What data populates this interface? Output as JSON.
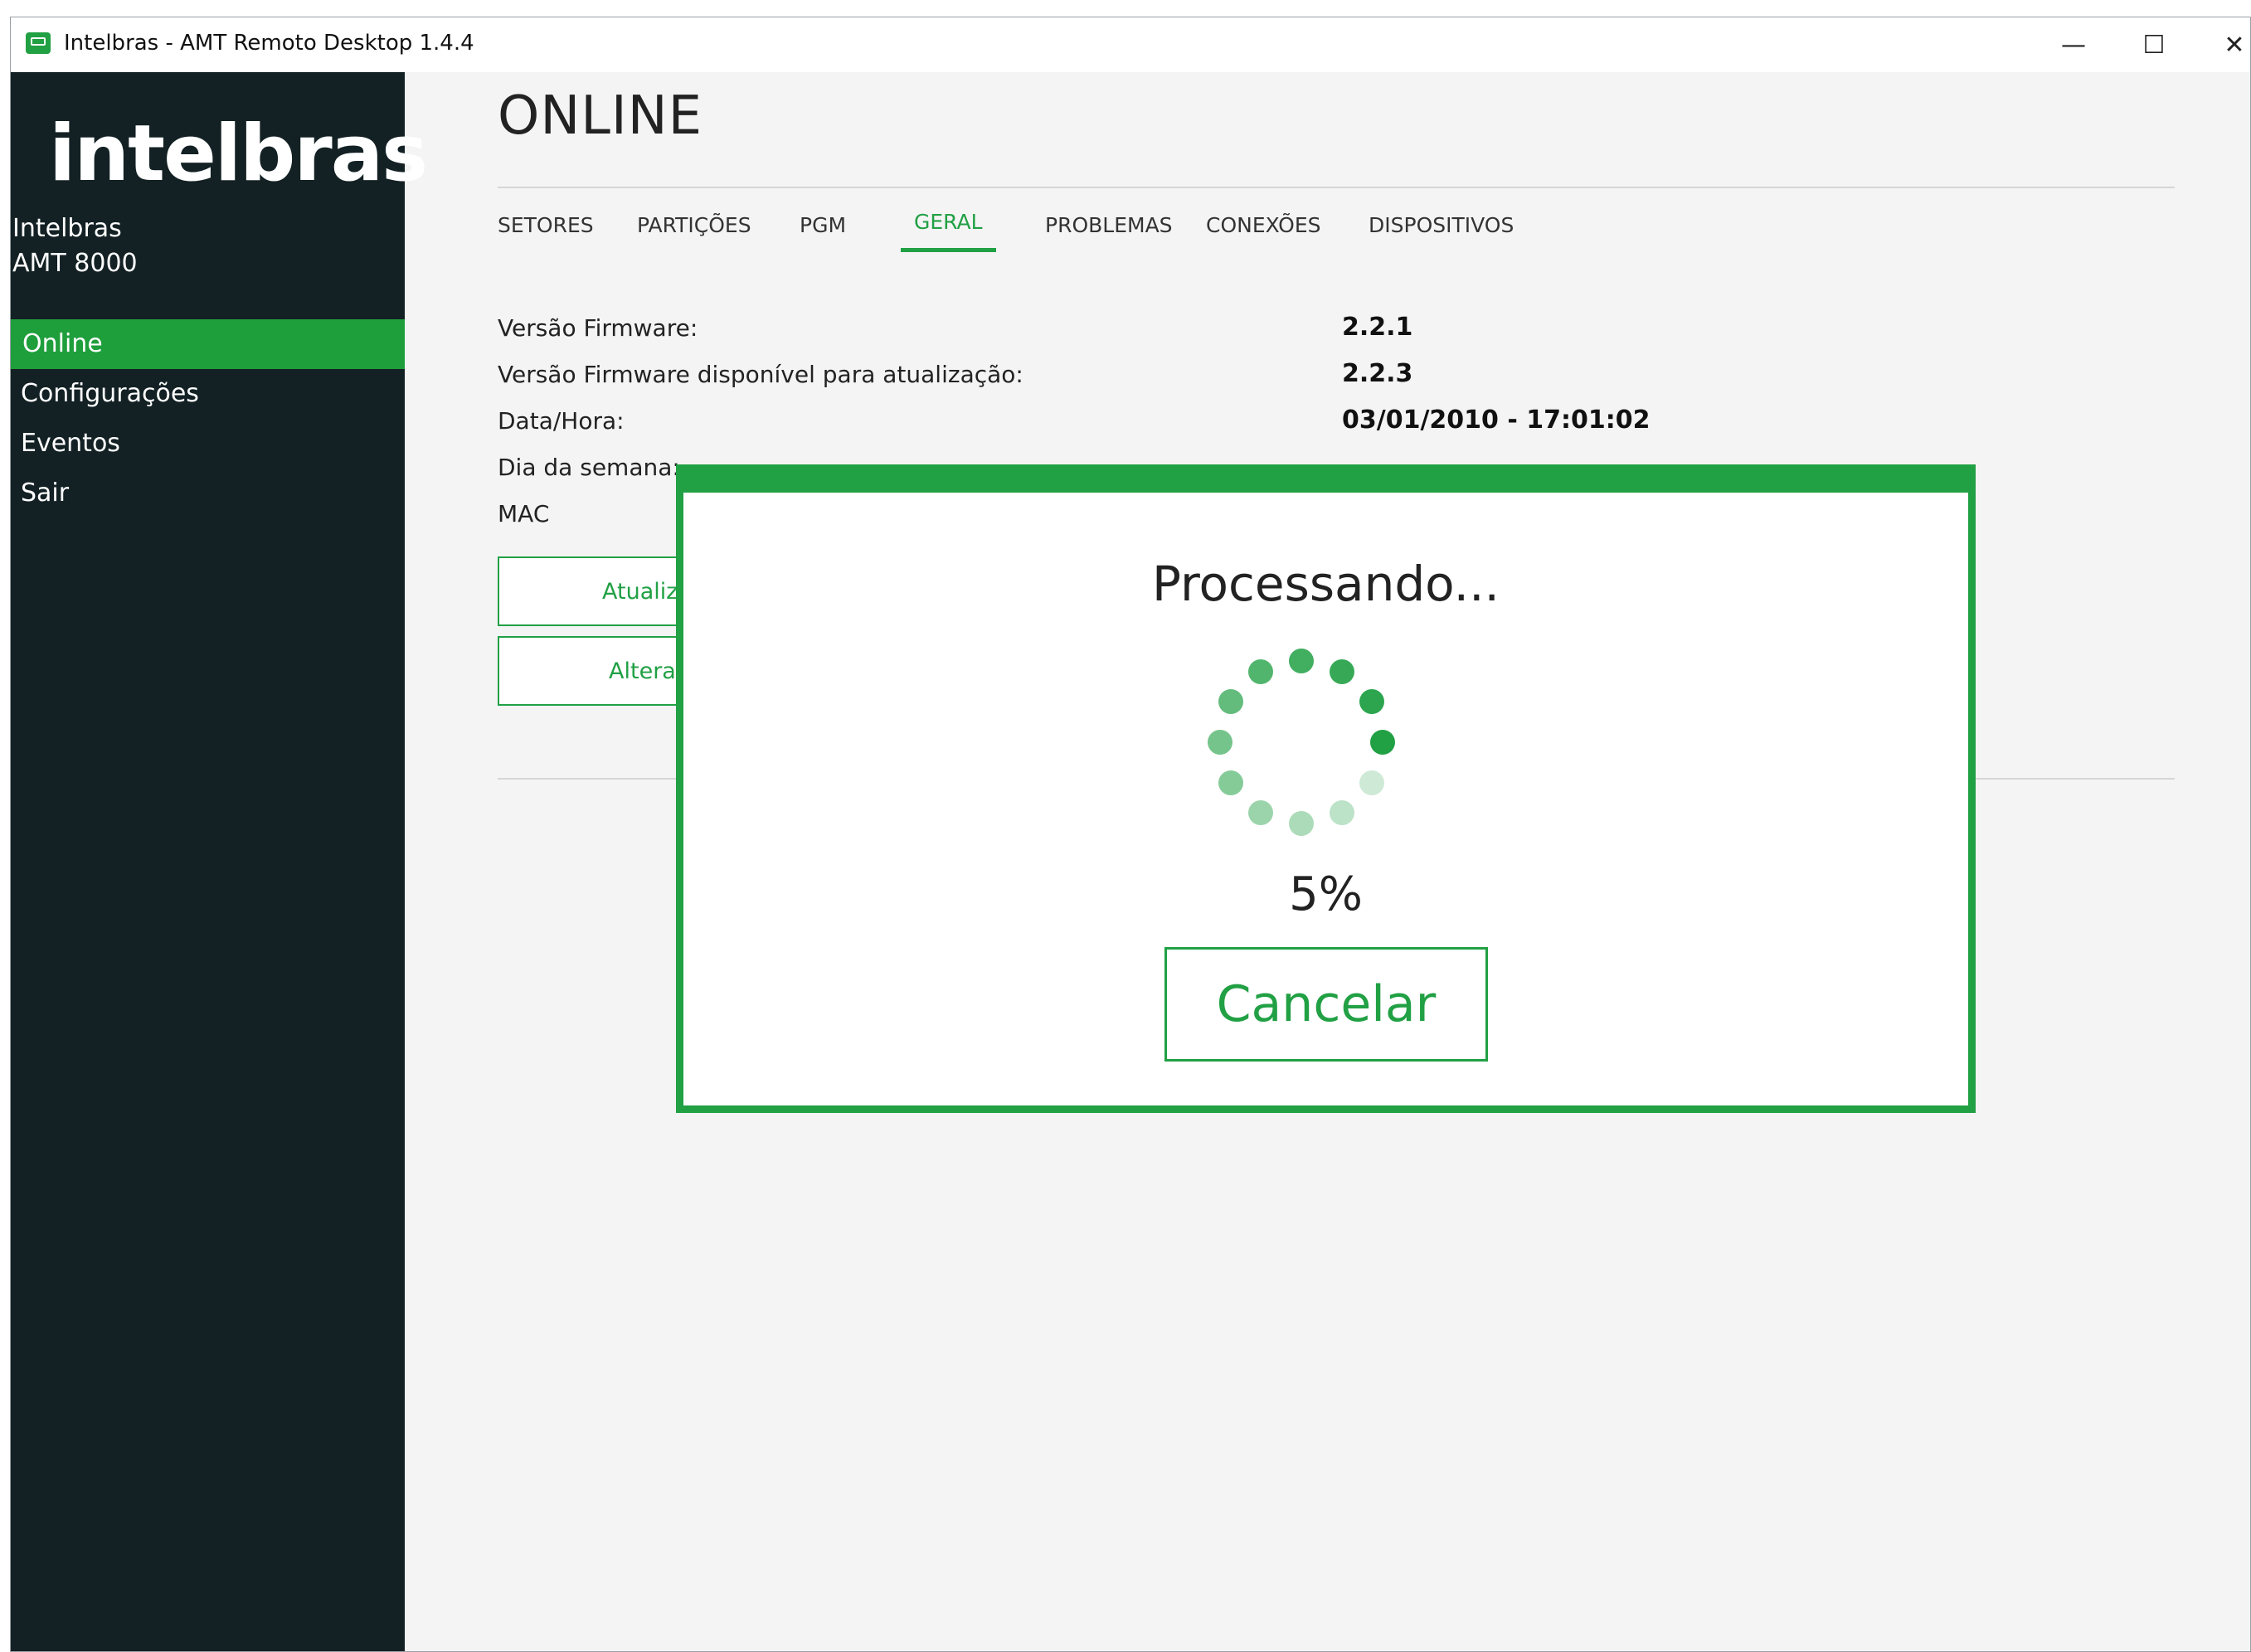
{
  "window": {
    "title": "Intelbras - AMT Remoto Desktop 1.4.4",
    "icon": "app-monitor-icon",
    "controls": {
      "minimize": "—",
      "maximize": "☐",
      "close": "✕"
    }
  },
  "sidebar": {
    "logo": "intelbras",
    "device_brand": "Intelbras",
    "device_model": "AMT 8000",
    "items": [
      {
        "label": "Online",
        "active": true
      },
      {
        "label": "Configurações",
        "active": false
      },
      {
        "label": "Eventos",
        "active": false
      },
      {
        "label": "Sair",
        "active": false
      }
    ]
  },
  "main": {
    "title": "ONLINE",
    "tabs": [
      {
        "label": "SETORES",
        "active": false
      },
      {
        "label": "PARTIÇÕES",
        "active": false
      },
      {
        "label": "PGM",
        "active": false
      },
      {
        "label": "GERAL",
        "active": true
      },
      {
        "label": "PROBLEMAS",
        "active": false
      },
      {
        "label": "CONEXÕES",
        "active": false
      },
      {
        "label": "DISPOSITIVOS",
        "active": false
      }
    ],
    "info": [
      {
        "label": "Versão Firmware:",
        "value": "2.2.1"
      },
      {
        "label": "Versão Firmware disponível para atualização:",
        "value": "2.2.3"
      },
      {
        "label": "Data/Hora:",
        "value": "03/01/2010 - 17:01:02"
      },
      {
        "label": "Dia da semana:",
        "value": ""
      },
      {
        "label": "MAC",
        "value": ""
      }
    ],
    "buttons": [
      {
        "label": "Atualiza"
      },
      {
        "label": "Alterar"
      }
    ]
  },
  "dialog": {
    "title": "Processando...",
    "progress_text": "5%",
    "progress_fraction": 0.05,
    "cancel_label": "Cancelar",
    "accent_color": "#21a044"
  },
  "colors": {
    "accent": "#21a044",
    "sidebar_bg": "#132124",
    "content_bg": "#f4f4f4"
  }
}
